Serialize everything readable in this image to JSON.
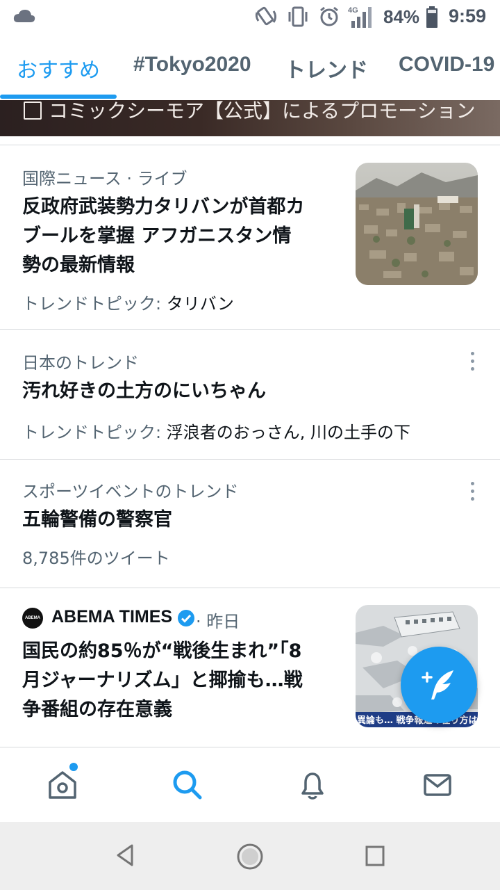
{
  "status_bar": {
    "battery": "84%",
    "time": "9:59",
    "network": "4G"
  },
  "tabs": [
    {
      "label": "おすすめ",
      "active": true
    },
    {
      "label": "#Tokyo2020",
      "active": false
    },
    {
      "label": "トレンド",
      "active": false
    },
    {
      "label": "COVID-19",
      "active": false
    }
  ],
  "promo": {
    "text": "コミックシーモア【公式】によるプロモーション"
  },
  "items": [
    {
      "meta": "国際ニュース · ライブ",
      "headline_lines": [
        "反政府武装勢力タリバンが首都カ",
        "ブールを掌握 アフガニスタン情",
        "勢の最新情報"
      ],
      "sub_prefix": "トレンドトピック:",
      "sub_topic": " タリバン"
    },
    {
      "meta": "日本のトレンド",
      "headline_lines": [
        "汚れ好きの土方のにいちゃん"
      ],
      "sub_prefix": "トレンドトピック:",
      "sub_topic": " 浮浪者のおっさん, 川の土手の下"
    },
    {
      "meta": "スポーツイベントのトレンド",
      "headline_lines": [
        "五輪警備の警察官"
      ],
      "sub": "8,785件のツイート"
    },
    {
      "source": "ABEMA TIMES",
      "source_logo_text": "ABEMA",
      "time": " · 昨日",
      "headline_lines": [
        "国民の約85％が“戦後生まれ”「8",
        "月ジャーナリズム」と揶揄も…戦",
        "争番組の存在意義"
      ],
      "thumb_caption": "異論も… 戦争報道の在り方は"
    }
  ],
  "colors": {
    "accent": "#1d9bf0",
    "secondary_text": "#536471",
    "primary_text": "#0f1419"
  },
  "icons": {
    "bottom_nav": [
      "home-icon",
      "search-icon",
      "notifications-icon",
      "messages-icon"
    ],
    "fab": "compose-tweet-icon"
  }
}
